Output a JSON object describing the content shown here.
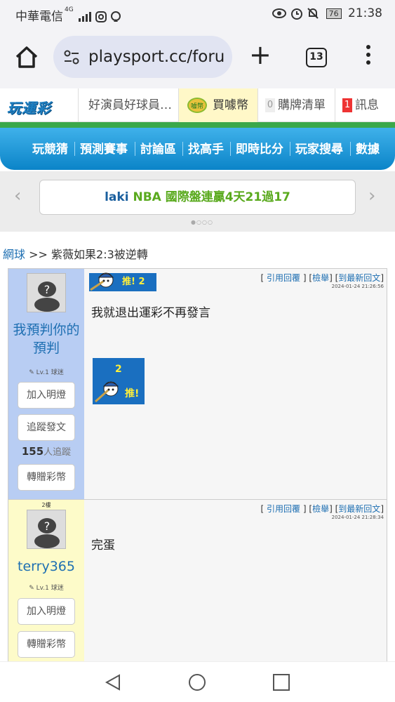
{
  "status_bar": {
    "carrier": "中華電信",
    "network": "4G",
    "battery": "76",
    "time": "21:38"
  },
  "browser": {
    "url": "playsport.cc/foru",
    "tab_count": "13"
  },
  "site": {
    "logo": "玩運彩",
    "top_nav": {
      "forum_title": "好演員好球員…",
      "buy_coin": "買噱幣",
      "buy_badge": "噱幣",
      "purchase_list_count": "0",
      "purchase_list": "購牌清單",
      "message_count": "1",
      "messages": "訊息"
    },
    "main_nav": [
      "玩競猜",
      "預測賽事",
      "討論區",
      "找高手",
      "即時比分",
      "玩家搜尋",
      "數據"
    ],
    "carousel": {
      "user": "laki",
      "text": "NBA 國際盤連贏4天21過17",
      "dots": "●○○○"
    }
  },
  "breadcrumb": {
    "section": "網球",
    "separator": ">>",
    "thread_title": "紫薇如果2:3被逆轉"
  },
  "posts": [
    {
      "floor": "",
      "username": "我預判你的預判",
      "level": "✎ Lv.1 球迷",
      "buttons": [
        "加入明燈",
        "追蹤發文"
      ],
      "follow_count": "155",
      "follow_suffix": "人追蹤",
      "gift_button": "轉贈彩幣",
      "push_label": "推!",
      "push_count": "2",
      "links": {
        "quote": "引用回覆",
        "report": "檢舉",
        "latest": "到最新回文"
      },
      "timestamp": "2024-01-24 21:26:56",
      "content": "我就退出運彩不再發言",
      "badge_count": "2",
      "badge_label": "推!"
    },
    {
      "floor": "2樓",
      "username": "terry365",
      "level": "✎ Lv.1 球迷",
      "buttons": [
        "加入明燈"
      ],
      "gift_button": "轉贈彩幣",
      "links": {
        "quote": "引用回覆",
        "report": "檢舉",
        "latest": "到最新回文"
      },
      "timestamp": "2024-01-24 21:28:34",
      "content": "完蛋"
    }
  ],
  "colors": {
    "post1_sidebar": "#b8cdf3",
    "post2_sidebar": "#fdfbc9",
    "accent_blue": "#1e6fb2"
  }
}
